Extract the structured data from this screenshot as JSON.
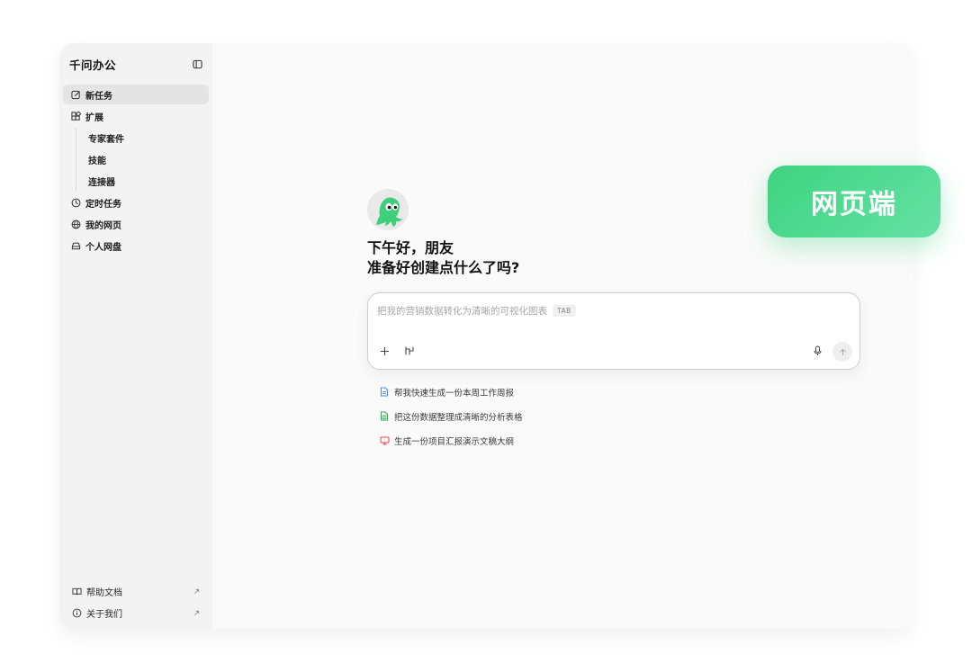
{
  "app": {
    "title": "千问办公"
  },
  "sidebar": {
    "items": [
      {
        "label": "新任务",
        "icon": "edit-icon",
        "active": true
      },
      {
        "label": "扩展",
        "icon": "apps-icon"
      }
    ],
    "sub_items": [
      {
        "label": "专家套件"
      },
      {
        "label": "技能"
      },
      {
        "label": "连接器"
      }
    ],
    "items_after": [
      {
        "label": "定时任务",
        "icon": "clock-icon"
      },
      {
        "label": "我的网页",
        "icon": "globe-icon"
      },
      {
        "label": "个人网盘",
        "icon": "drive-icon"
      }
    ],
    "footer": [
      {
        "label": "帮助文档",
        "icon": "book-icon"
      },
      {
        "label": "关于我们",
        "icon": "info-icon"
      }
    ]
  },
  "main": {
    "greeting_line1": "下午好，朋友",
    "greeting_line2": "准备好创建点什么了吗?",
    "composer": {
      "placeholder": "把我的营销数据转化为清晰的可视化图表",
      "tab_hint": "TAB"
    },
    "suggestions": [
      {
        "label": "帮我快速生成一份本周工作周报",
        "icon": "doc-icon",
        "color": "#3b8df0"
      },
      {
        "label": "把这份数据整理成清晰的分析表格",
        "icon": "sheet-icon",
        "color": "#2fb35a"
      },
      {
        "label": "生成一份项目汇报演示文稿大纲",
        "icon": "slides-icon",
        "color": "#e84a3f"
      }
    ]
  },
  "badge": {
    "label": "网页端",
    "color": "#3ed37f"
  }
}
